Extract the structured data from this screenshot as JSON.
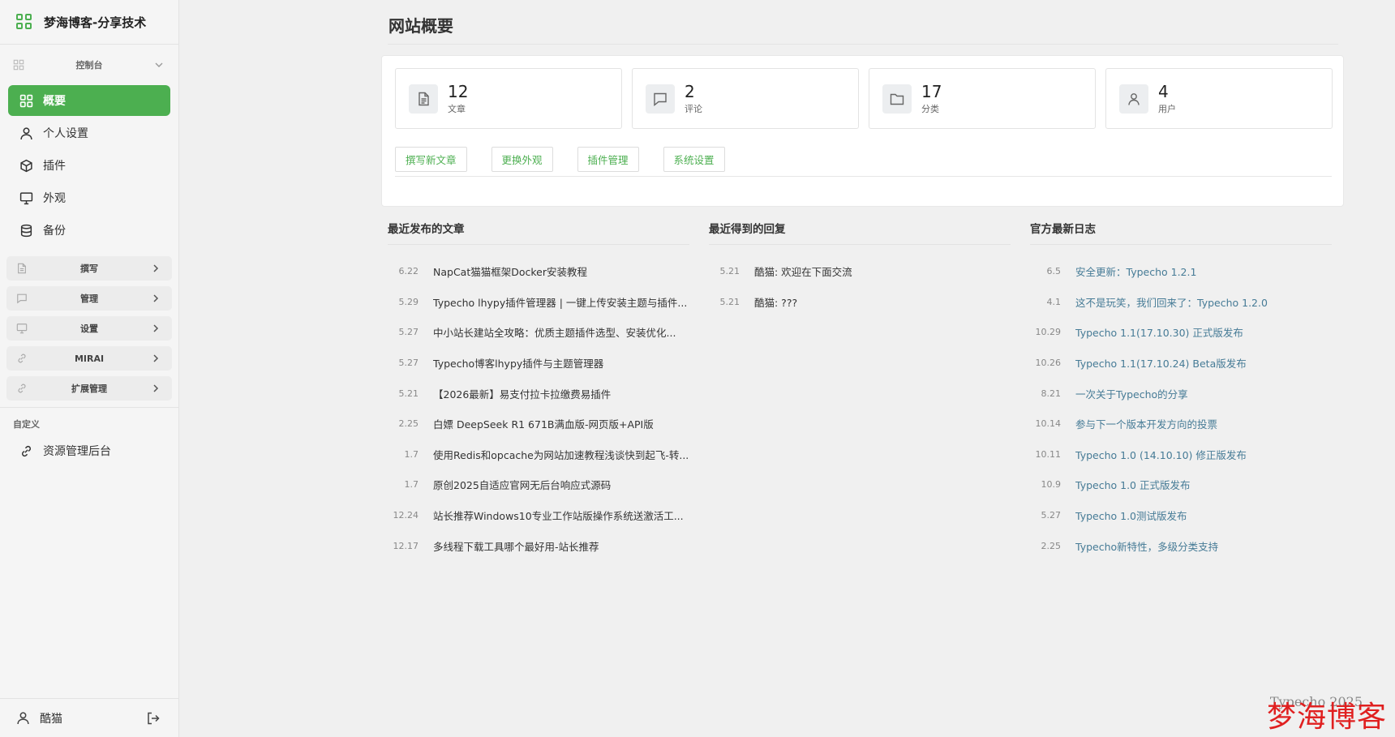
{
  "brand": {
    "title": "梦海博客-分享技术"
  },
  "sidebar": {
    "group_label": "控制台",
    "items": [
      {
        "label": "概要",
        "icon": "grid-icon",
        "active": true
      },
      {
        "label": "个人设置",
        "icon": "user-icon"
      },
      {
        "label": "插件",
        "icon": "cube-icon"
      },
      {
        "label": "外观",
        "icon": "monitor-icon"
      },
      {
        "label": "备份",
        "icon": "database-icon"
      }
    ],
    "collapsibles": [
      {
        "label": "撰写",
        "icon": "file-icon"
      },
      {
        "label": "管理",
        "icon": "chat-icon"
      },
      {
        "label": "设置",
        "icon": "monitor-icon"
      },
      {
        "label": "MIRAI",
        "icon": "link-icon"
      },
      {
        "label": "扩展管理",
        "icon": "link-icon"
      }
    ],
    "custom_label": "自定义",
    "custom_items": [
      {
        "label": "资源管理后台",
        "icon": "link-icon"
      }
    ],
    "footer": {
      "username": "酷猫"
    }
  },
  "main": {
    "title": "网站概要",
    "stats": [
      {
        "value": "12",
        "label": "文章",
        "icon": "document-icon"
      },
      {
        "value": "2",
        "label": "评论",
        "icon": "comment-icon"
      },
      {
        "value": "17",
        "label": "分类",
        "icon": "folder-icon"
      },
      {
        "value": "4",
        "label": "用户",
        "icon": "user-icon"
      }
    ],
    "actions": [
      "撰写新文章",
      "更换外观",
      "插件管理",
      "系统设置"
    ],
    "recent_posts": {
      "title": "最近发布的文章",
      "items": [
        {
          "date": "6.22",
          "text": "NapCat猫猫框架Docker安装教程"
        },
        {
          "date": "5.29",
          "text": "Typecho lhypy插件管理器 | 一键上传安装主题与插件..."
        },
        {
          "date": "5.27",
          "text": "中小站长建站全攻略：优质主题插件选型、安装优化..."
        },
        {
          "date": "5.27",
          "text": "Typecho博客lhypy插件与主题管理器"
        },
        {
          "date": "5.21",
          "text": "【2026最新】易支付拉卡拉缴费易插件"
        },
        {
          "date": "2.25",
          "text": "白嫖 DeepSeek R1 671B满血版-网页版+API版"
        },
        {
          "date": "1.7",
          "text": "使用Redis和opcache为网站加速教程浅谈快到起飞-转..."
        },
        {
          "date": "1.7",
          "text": "原创2025自适应官网无后台响应式源码"
        },
        {
          "date": "12.24",
          "text": "站长推荐Windows10专业工作站版操作系统送激活工..."
        },
        {
          "date": "12.17",
          "text": "多线程下载工具哪个最好用-站长推荐"
        }
      ]
    },
    "recent_replies": {
      "title": "最近得到的回复",
      "items": [
        {
          "date": "5.21",
          "text": "酷猫: 欢迎在下面交流"
        },
        {
          "date": "5.21",
          "text": "酷猫: ???"
        }
      ]
    },
    "official_log": {
      "title": "官方最新日志",
      "items": [
        {
          "date": "6.5",
          "text": "安全更新：Typecho 1.2.1"
        },
        {
          "date": "4.1",
          "text": "这不是玩笑，我们回来了：Typecho 1.2.0"
        },
        {
          "date": "10.29",
          "text": "Typecho 1.1(17.10.30) 正式版发布"
        },
        {
          "date": "10.26",
          "text": "Typecho 1.1(17.10.24) Beta版发布"
        },
        {
          "date": "8.21",
          "text": "一次关于Typecho的分享"
        },
        {
          "date": "10.14",
          "text": "参与下一个版本开发方向的投票"
        },
        {
          "date": "10.11",
          "text": "Typecho 1.0 (14.10.10) 修正版发布"
        },
        {
          "date": "10.9",
          "text": "Typecho 1.0 正式版发布"
        },
        {
          "date": "5.27",
          "text": "Typecho 1.0测试版发布"
        },
        {
          "date": "2.25",
          "text": "Typecho新特性，多级分类支持"
        }
      ]
    }
  },
  "watermark": {
    "small": "Typecho 2025",
    "large": "梦海博客"
  },
  "colors": {
    "accent": "#4caf50",
    "link": "#467b96",
    "watermark": "#e02020"
  }
}
